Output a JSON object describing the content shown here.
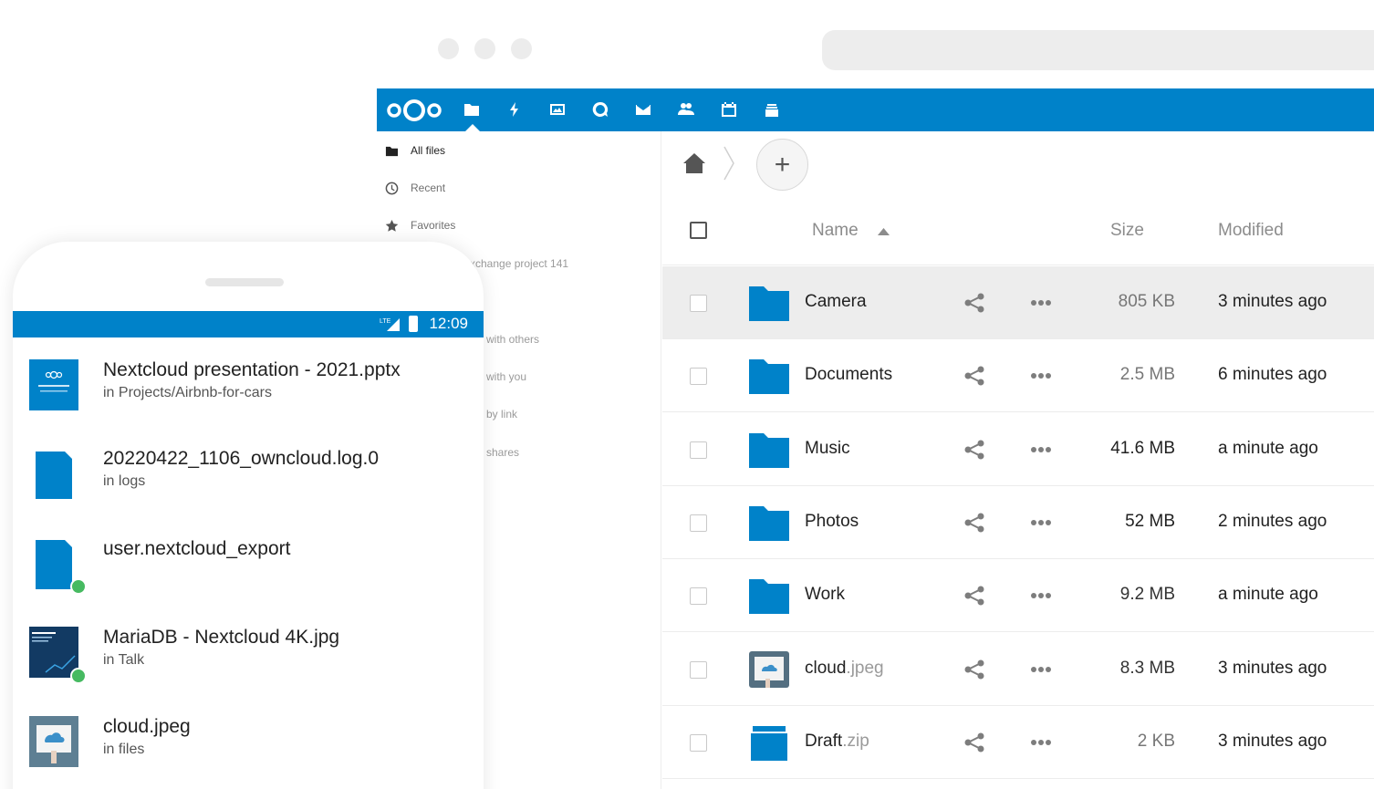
{
  "nav": {
    "items": [
      {
        "label": "All files",
        "icon": "folder-icon"
      },
      {
        "label": "Recent",
        "icon": "clock-icon"
      },
      {
        "label": "Favorites",
        "icon": "star-icon"
      }
    ],
    "fragments": [
      "xchange project 141",
      "with others",
      "with you",
      "by link",
      "l shares"
    ]
  },
  "toolbar": {
    "add_label": "+"
  },
  "list": {
    "headers": {
      "name": "Name",
      "size": "Size",
      "modified": "Modified"
    },
    "rows": [
      {
        "name": "Camera",
        "ext": "",
        "size": "805 KB",
        "modified": "3 minutes ago",
        "type": "folder",
        "size_color": "#777777"
      },
      {
        "name": "Documents",
        "ext": "",
        "size": "2.5 MB",
        "modified": "6 minutes ago",
        "type": "folder",
        "size_color": "#777777"
      },
      {
        "name": "Music",
        "ext": "",
        "size": "41.6 MB",
        "modified": "a minute ago",
        "type": "folder",
        "size_color": "#222222"
      },
      {
        "name": "Photos",
        "ext": "",
        "size": "52 MB",
        "modified": "2 minutes ago",
        "type": "folder",
        "size_color": "#222222"
      },
      {
        "name": "Work",
        "ext": "",
        "size": "9.2 MB",
        "modified": "a minute ago",
        "type": "folder",
        "size_color": "#333333"
      },
      {
        "name": "cloud",
        "ext": ".jpeg",
        "size": "8.3 MB",
        "modified": "3 minutes ago",
        "type": "image",
        "size_color": "#333333"
      },
      {
        "name": "Draft",
        "ext": ".zip",
        "size": "2 KB",
        "modified": "3 minutes ago",
        "type": "zip",
        "size_color": "#777777"
      }
    ]
  },
  "phone": {
    "time": "12:09",
    "network": "LTE",
    "items": [
      {
        "title": "Nextcloud presentation - 2021.pptx",
        "sub": "in Projects/Airbnb-for-cars"
      },
      {
        "title": "20220422_1106_owncloud.log.0",
        "sub": "in logs"
      },
      {
        "title": "user.nextcloud_export",
        "sub": ""
      },
      {
        "title": "MariaDB - Nextcloud 4K.jpg",
        "sub": "in Talk"
      },
      {
        "title": "cloud.jpeg",
        "sub": "in files"
      }
    ]
  },
  "colors": {
    "brand": "#0082c9",
    "folder": "#0082c9",
    "selected_row": "#ededed",
    "sync_badge": "#46ba61"
  }
}
